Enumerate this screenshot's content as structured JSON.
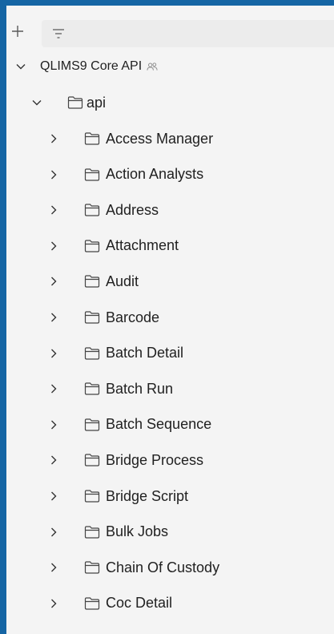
{
  "toolbar": {
    "add_icon": "plus-icon",
    "filter_icon": "filter-icon",
    "filter_value": "",
    "filter_placeholder": ""
  },
  "tree": {
    "root": {
      "label": "QLIMS9 Core API",
      "expanded": true,
      "badge_icon": "team-icon"
    },
    "folder": {
      "label": "api",
      "expanded": true
    },
    "items": [
      {
        "label": "Access Manager"
      },
      {
        "label": "Action Analysts"
      },
      {
        "label": "Address"
      },
      {
        "label": "Attachment"
      },
      {
        "label": "Audit"
      },
      {
        "label": "Barcode"
      },
      {
        "label": "Batch Detail"
      },
      {
        "label": "Batch Run"
      },
      {
        "label": "Batch Sequence"
      },
      {
        "label": "Bridge Process"
      },
      {
        "label": "Bridge Script"
      },
      {
        "label": "Bulk Jobs"
      },
      {
        "label": "Chain Of Custody"
      },
      {
        "label": "Coc Detail"
      }
    ]
  },
  "colors": {
    "frame": "#1565a4",
    "panel": "#f4f4f4",
    "text": "#212121",
    "icon": "#5a5a5a"
  }
}
